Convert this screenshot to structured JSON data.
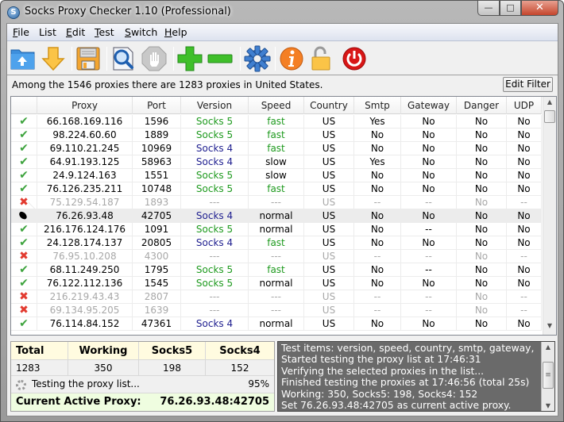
{
  "window": {
    "title": "Socks Proxy Checker 1.10 (Professional)",
    "app_icon": "S",
    "controls": {
      "minimize": "—",
      "maximize": "□",
      "close": "✕"
    }
  },
  "menu": [
    {
      "label": "File",
      "accel": "F",
      "rest": "ile"
    },
    {
      "label": "List",
      "accel": "",
      "rest": "List"
    },
    {
      "label": "Edit",
      "accel": "E",
      "rest": "dit"
    },
    {
      "label": "Test",
      "accel": "T",
      "rest": "est"
    },
    {
      "label": "Switch",
      "accel": "S",
      "rest": "witch"
    },
    {
      "label": "Help",
      "accel": "H",
      "rest": "elp"
    }
  ],
  "toolbar": [
    {
      "name": "open-folder-icon"
    },
    {
      "name": "download-arrow-icon"
    },
    {
      "name": "save-floppy-icon"
    },
    {
      "name": "search-magnifier-icon"
    },
    {
      "name": "stop-hand-icon"
    },
    {
      "name": "add-plus-icon"
    },
    {
      "name": "remove-minus-icon"
    },
    {
      "name": "settings-gear-icon"
    },
    {
      "name": "info-icon"
    },
    {
      "name": "unlock-padlock-icon"
    },
    {
      "name": "power-icon"
    }
  ],
  "filter": {
    "text": "Among the 1546 proxies there are 1283 proxies in United States.",
    "button": "Edit Filter"
  },
  "grid": {
    "columns": [
      "",
      "Proxy",
      "Port",
      "Version",
      "Speed",
      "Country",
      "Smtp",
      "Gateway",
      "Danger",
      "UDP"
    ],
    "rows": [
      {
        "status": "ok",
        "proxy": "66.168.169.116",
        "port": "1596",
        "version": "Socks 5",
        "speed": "fast",
        "country": "US",
        "smtp": "Yes",
        "gateway": "No",
        "danger": "No",
        "udp": "No"
      },
      {
        "status": "ok",
        "proxy": "98.224.60.60",
        "port": "1889",
        "version": "Socks 5",
        "speed": "fast",
        "country": "US",
        "smtp": "No",
        "gateway": "No",
        "danger": "No",
        "udp": "No"
      },
      {
        "status": "ok",
        "proxy": "69.110.21.245",
        "port": "10969",
        "version": "Socks 4",
        "speed": "fast",
        "country": "US",
        "smtp": "No",
        "gateway": "No",
        "danger": "No",
        "udp": "No"
      },
      {
        "status": "ok",
        "proxy": "64.91.193.125",
        "port": "58963",
        "version": "Socks 4",
        "speed": "slow",
        "country": "US",
        "smtp": "Yes",
        "gateway": "No",
        "danger": "No",
        "udp": "No"
      },
      {
        "status": "ok",
        "proxy": "24.9.124.163",
        "port": "1551",
        "version": "Socks 5",
        "speed": "slow",
        "country": "US",
        "smtp": "No",
        "gateway": "No",
        "danger": "No",
        "udp": "No"
      },
      {
        "status": "ok",
        "proxy": "76.126.235.211",
        "port": "10748",
        "version": "Socks 5",
        "speed": "fast",
        "country": "US",
        "smtp": "No",
        "gateway": "No",
        "danger": "No",
        "udp": "No"
      },
      {
        "status": "bad",
        "proxy": "75.129.54.187",
        "port": "1893",
        "version": "---",
        "speed": "---",
        "country": "US",
        "smtp": "--",
        "gateway": "--",
        "danger": "No",
        "udp": "--"
      },
      {
        "status": "active",
        "proxy": "76.26.93.48",
        "port": "42705",
        "version": "Socks 4",
        "speed": "normal",
        "country": "US",
        "smtp": "No",
        "gateway": "No",
        "danger": "No",
        "udp": "No"
      },
      {
        "status": "ok",
        "proxy": "216.176.124.176",
        "port": "1091",
        "version": "Socks 5",
        "speed": "normal",
        "country": "US",
        "smtp": "No",
        "gateway": "--",
        "danger": "No",
        "udp": "No"
      },
      {
        "status": "ok",
        "proxy": "24.128.174.137",
        "port": "20805",
        "version": "Socks 4",
        "speed": "fast",
        "country": "US",
        "smtp": "No",
        "gateway": "No",
        "danger": "No",
        "udp": "No"
      },
      {
        "status": "bad",
        "proxy": "76.95.10.208",
        "port": "4300",
        "version": "---",
        "speed": "---",
        "country": "US",
        "smtp": "--",
        "gateway": "--",
        "danger": "No",
        "udp": "--"
      },
      {
        "status": "ok",
        "proxy": "68.11.249.250",
        "port": "1795",
        "version": "Socks 5",
        "speed": "fast",
        "country": "US",
        "smtp": "No",
        "gateway": "--",
        "danger": "No",
        "udp": "No"
      },
      {
        "status": "ok",
        "proxy": "76.122.112.136",
        "port": "1545",
        "version": "Socks 5",
        "speed": "normal",
        "country": "US",
        "smtp": "No",
        "gateway": "No",
        "danger": "No",
        "udp": "No"
      },
      {
        "status": "bad",
        "proxy": "216.219.43.43",
        "port": "2807",
        "version": "---",
        "speed": "---",
        "country": "US",
        "smtp": "--",
        "gateway": "--",
        "danger": "No",
        "udp": "--"
      },
      {
        "status": "bad",
        "proxy": "69.134.95.205",
        "port": "1639",
        "version": "---",
        "speed": "---",
        "country": "US",
        "smtp": "--",
        "gateway": "--",
        "danger": "No",
        "udp": "--"
      },
      {
        "status": "ok",
        "proxy": "76.114.84.152",
        "port": "47361",
        "version": "Socks 4",
        "speed": "normal",
        "country": "US",
        "smtp": "No",
        "gateway": "No",
        "danger": "No",
        "udp": "No"
      }
    ],
    "selected_row": 7
  },
  "stats": {
    "headers": [
      "Total",
      "Working",
      "Socks5",
      "Socks4"
    ],
    "values": [
      "1283",
      "350",
      "198",
      "152"
    ],
    "progress_text": "Testing the proxy list...",
    "progress_percent": "95%",
    "active_label": "Current Active Proxy:",
    "active_value": "76.26.93.48:42705"
  },
  "log": [
    "Test items: version, speed, country, smtp, gateway, danger",
    "Started testing the proxy list at 17:46:31",
    "Verifying the selected proxies in the list...",
    "Finished testing the proxies at 17:46:56 (total 25s)",
    "Working: 350, Socks5: 198, Socks4: 152",
    "Set 76.26.93.48:42705 as current active proxy."
  ],
  "colors": {
    "ok": "#3da33d",
    "bad": "#e23a2f",
    "socks5": "#1e9a1e",
    "socks4": "#202090",
    "log_bg": "#6a6a6a",
    "stats_header_bg": "#fffbe0",
    "active_bg": "#effde0"
  }
}
